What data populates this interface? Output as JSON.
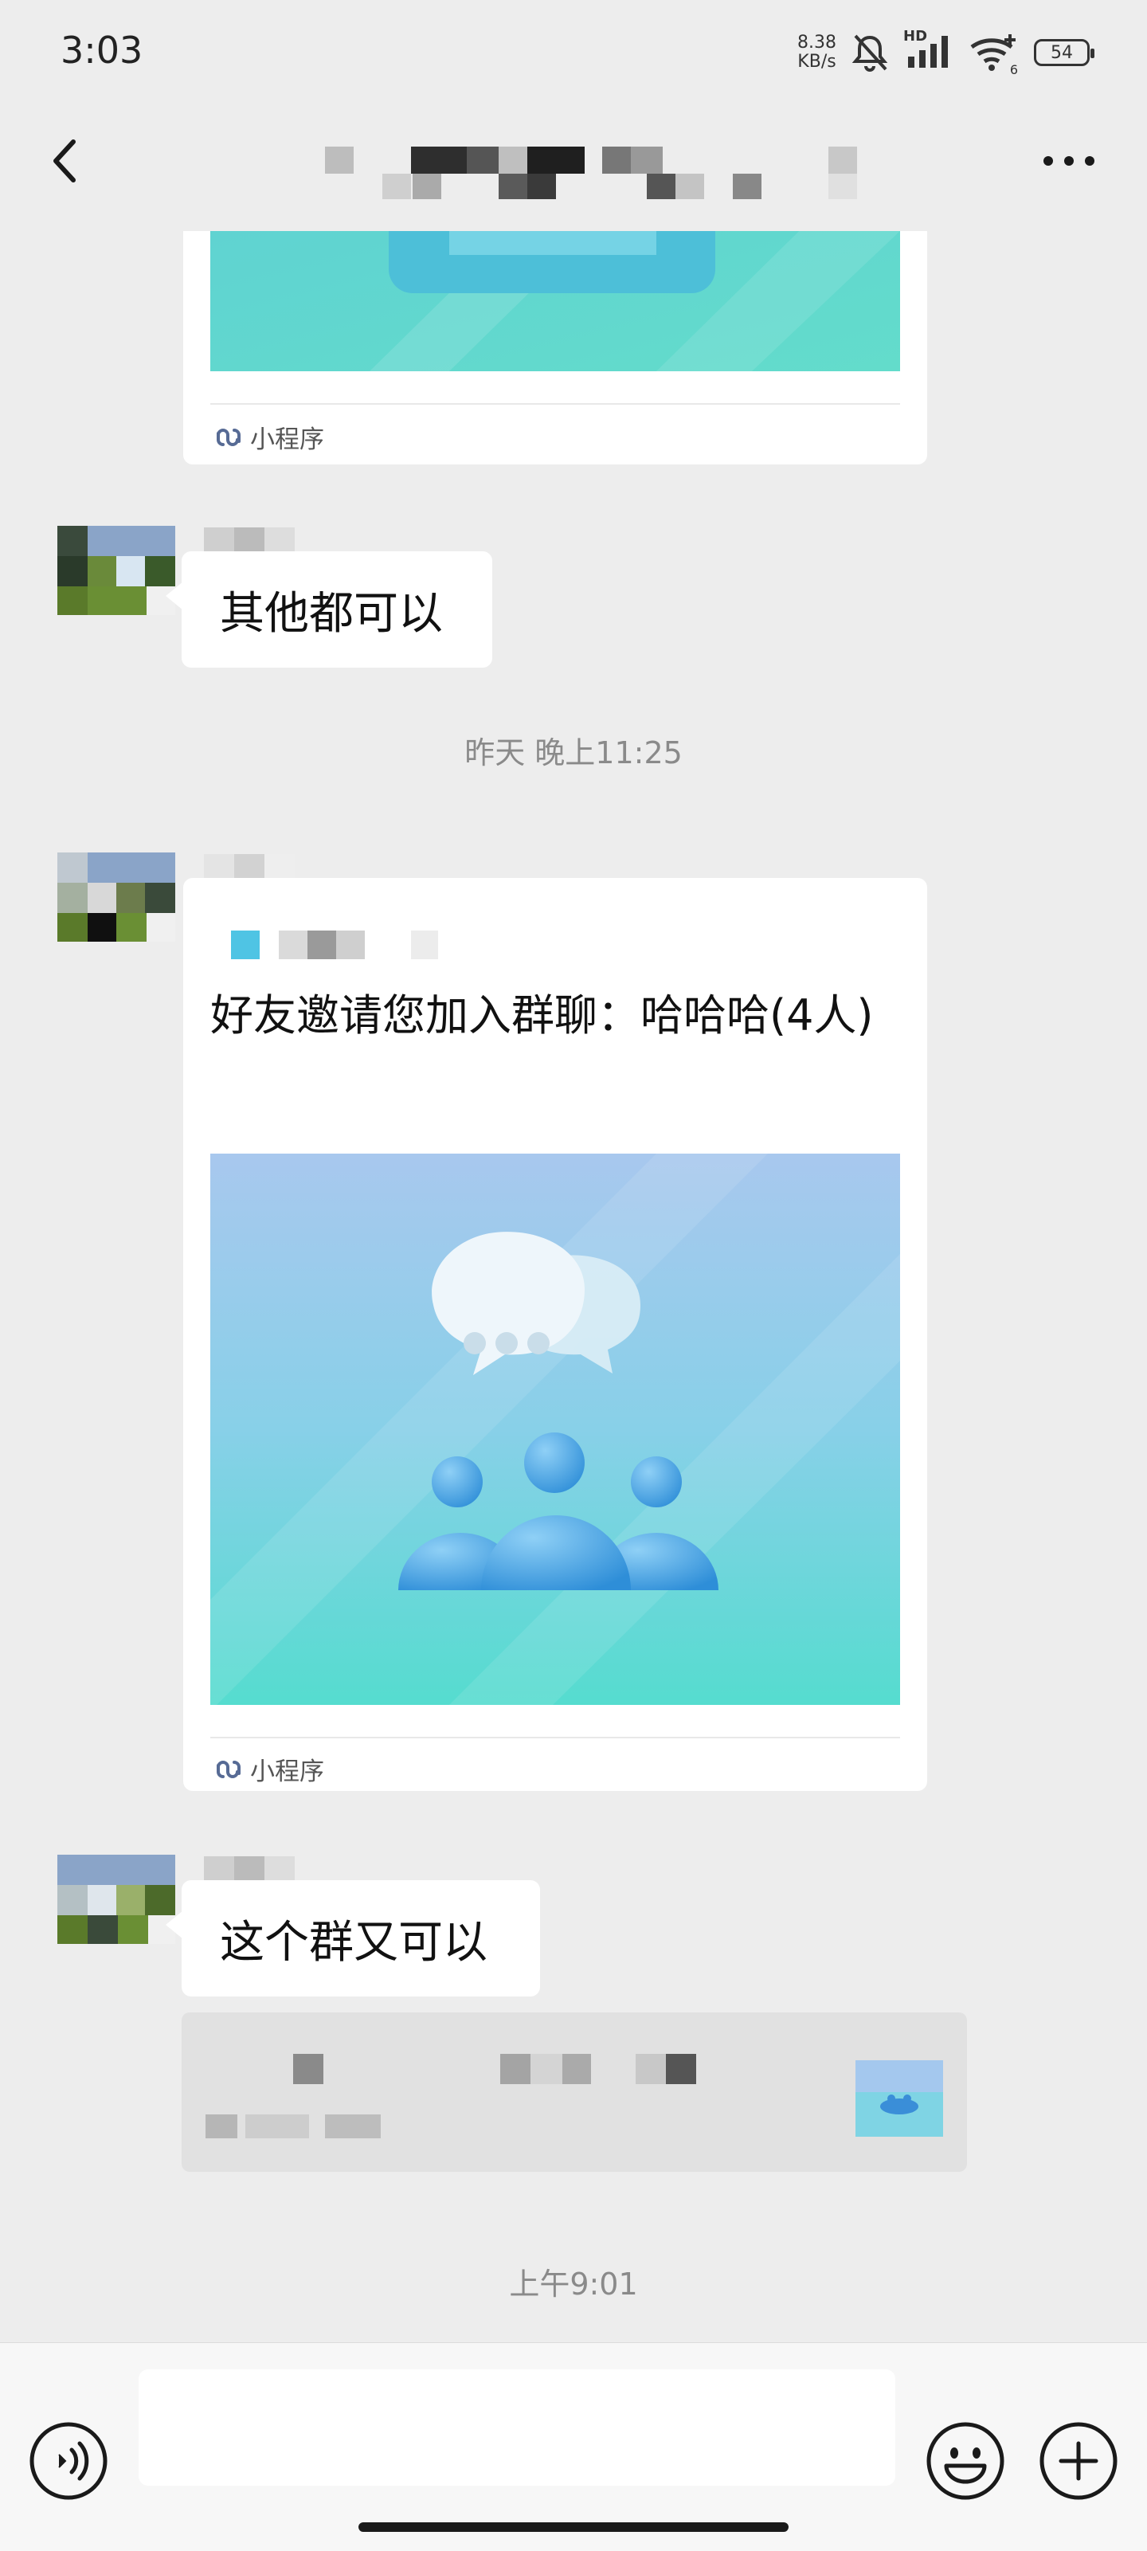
{
  "status_bar": {
    "time": "3:03",
    "net_speed_value": "8.38",
    "net_speed_unit": "KB/s",
    "battery": "54",
    "hd_label": "HD",
    "wifi_sub": "6"
  },
  "nav": {
    "back_icon": "chevron-left-icon",
    "more_icon": "ellipsis-icon"
  },
  "messages": {
    "mini_program_label": "小程序",
    "msg1_text": "其他都可以",
    "timestamp1": "昨天 晚上11:25",
    "invite_title": "好友邀请您加入群聊：哈哈哈(4人)",
    "msg2_text": "这个群又可以",
    "timestamp2": "上午9:01"
  },
  "colors": {
    "background": "#ededed",
    "bubble": "#ffffff",
    "timestamp": "#8a8a8a",
    "mini_program_icon": "#576b95",
    "card_teal": "#5fd6cf",
    "card_blue": "#9cc8ee"
  }
}
